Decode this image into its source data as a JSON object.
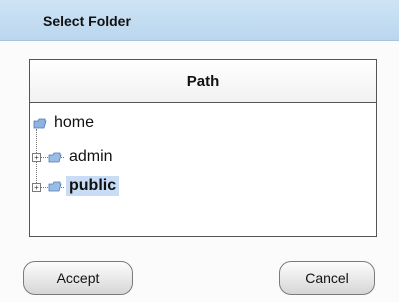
{
  "dialog": {
    "title": "Select Folder"
  },
  "panel": {
    "header": "Path"
  },
  "tree": {
    "root": {
      "label": "home",
      "icon": "folder-icon"
    },
    "children": [
      {
        "label": "admin",
        "icon": "folder-icon",
        "expander": "+",
        "selected": false
      },
      {
        "label": "public",
        "icon": "folder-icon",
        "expander": "+",
        "selected": true
      }
    ]
  },
  "buttons": {
    "accept": "Accept",
    "cancel": "Cancel"
  },
  "colors": {
    "titlebar": "#c4ddf2",
    "selection": "#c8dcf6",
    "folder": "#8fb3de"
  }
}
